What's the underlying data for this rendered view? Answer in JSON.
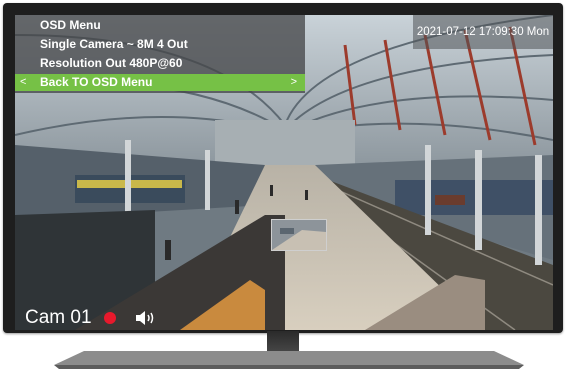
{
  "osd_menu": {
    "title": "OSD Menu",
    "camera_mode": "Single Camera ~ 8M  4 Out",
    "resolution": "Resolution Out  480P@60",
    "back_item": "Back TO OSD Menu",
    "back_left_arrow": "<",
    "back_right_arrow": ">",
    "highlight_color": "#76c146"
  },
  "overlay": {
    "timestamp": "2021-07-12 17:09:30 Mon",
    "camera_name": "Cam 01",
    "recording_indicator_color": "#e8192c",
    "audio_icon": "speaker-icon"
  },
  "device": {
    "bezel_color": "#1e1e1e"
  }
}
